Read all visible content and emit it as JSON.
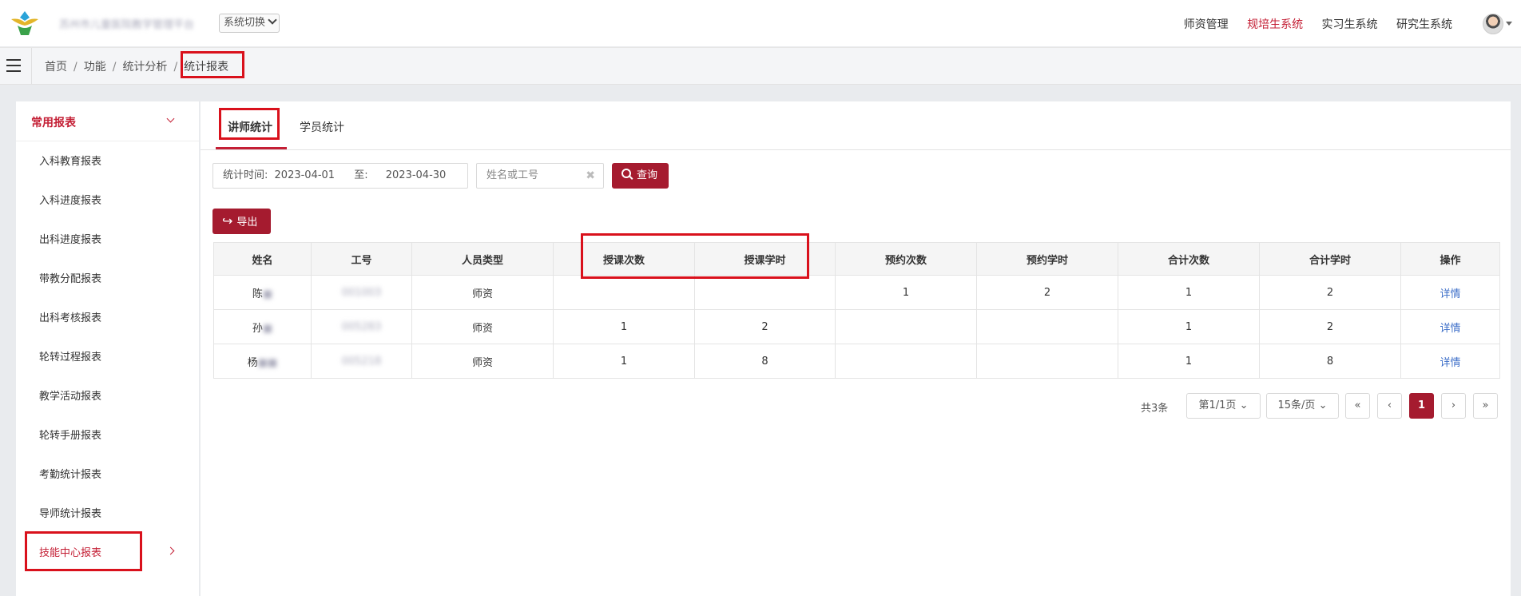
{
  "header": {
    "brand_text": "苏州市儿童医院教学管理平台",
    "system_switch": "系统切换",
    "nav": [
      {
        "label": "师资管理",
        "active": false
      },
      {
        "label": "规培生系统",
        "active": true
      },
      {
        "label": "实习生系统",
        "active": false
      },
      {
        "label": "研究生系统",
        "active": false
      }
    ]
  },
  "breadcrumb": [
    "首页",
    "功能",
    "统计分析",
    "统计报表"
  ],
  "sidebar": {
    "group_label": "常用报表",
    "items": [
      "入科教育报表",
      "入科进度报表",
      "出科进度报表",
      "带教分配报表",
      "出科考核报表",
      "轮转过程报表",
      "教学活动报表",
      "轮转手册报表",
      "考勤统计报表",
      "导师统计报表",
      "技能中心报表"
    ]
  },
  "tabs": [
    {
      "label": "讲师统计",
      "active": true
    },
    {
      "label": "学员统计",
      "active": false
    }
  ],
  "filters": {
    "date_label": "统计时间:",
    "date_from": "2023-04-01",
    "date_to_label": "至:",
    "date_to": "2023-04-30",
    "keyword_placeholder": "姓名或工号",
    "query_label": "查询",
    "export_label": "导出"
  },
  "table": {
    "headers": [
      "姓名",
      "工号",
      "人员类型",
      "授课次数",
      "授课学时",
      "预约次数",
      "预约学时",
      "合计次数",
      "合计学时",
      "操作"
    ],
    "rows": [
      {
        "name": "陈",
        "id": "001003",
        "type": "师资",
        "teach_count": "",
        "teach_hours": "",
        "book_count": "1",
        "book_hours": "2",
        "total_count": "1",
        "total_hours": "2",
        "action": "详情"
      },
      {
        "name": "孙",
        "id": "005283",
        "type": "师资",
        "teach_count": "1",
        "teach_hours": "2",
        "book_count": "",
        "book_hours": "",
        "total_count": "1",
        "total_hours": "2",
        "action": "详情"
      },
      {
        "name": "杨",
        "id": "005218",
        "type": "师资",
        "teach_count": "1",
        "teach_hours": "8",
        "book_count": "",
        "book_hours": "",
        "total_count": "1",
        "total_hours": "8",
        "action": "详情"
      }
    ]
  },
  "pagination": {
    "total": "共3条",
    "page_select": "第1/1页",
    "size_select": "15条/页",
    "first": "«",
    "prev": "‹",
    "current": "1",
    "next": "›",
    "last": "»"
  },
  "colors": {
    "accent": "#a51b2f",
    "highlight": "#d9111c",
    "link": "#3c6ec8"
  }
}
